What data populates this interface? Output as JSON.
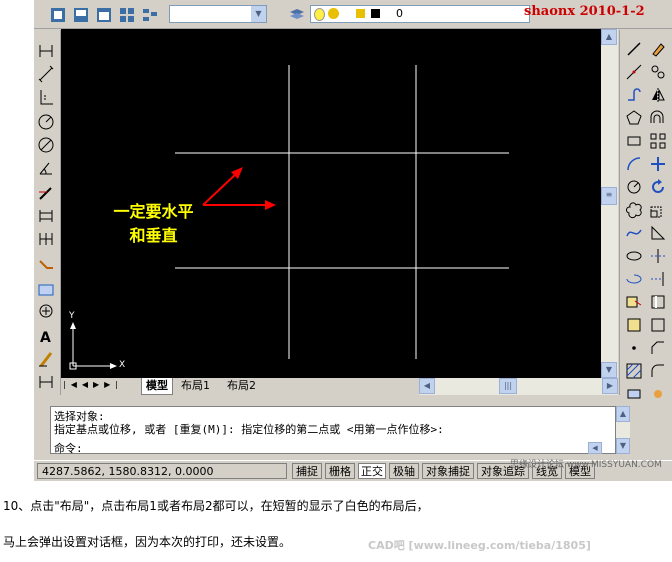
{
  "top_toolbar": {
    "layer_value": "0",
    "watermark": "shaonx  2010-1-2"
  },
  "canvas": {
    "annotation_line1": "一定要水平",
    "annotation_line2": "和垂直",
    "axis_x": "X",
    "axis_y": "Y"
  },
  "tabs": [
    "模型",
    "布局1",
    "布局2"
  ],
  "command": {
    "line1": "选择对象:",
    "line2": "指定基点或位移, 或者 [重复(M)]: 指定位移的第二点或 <用第一点作位移>:",
    "prompt": "命令:"
  },
  "status_bar": {
    "coordinates": "4287.5862, 1580.8312, 0.0000",
    "toggles": [
      "捕捉",
      "栅格",
      "正交",
      "极轴",
      "对象捕捉",
      "对象追踪",
      "线宽",
      "模型"
    ],
    "watermark": "思缘设计论坛 www.MISSYUAN.COM"
  },
  "captions": {
    "line1": "10、点击\"布局\"，点击布局1或者布局2都可以，在短暂的显示了白色的布局后，",
    "line2": "马上会弹出设置对话框，因为本次的打印，还未设置。",
    "watermark": "CAD吧  [www.lineeg.com/tieba/1805]"
  },
  "colors": {
    "canvas_bg": "#000000",
    "annotation": "#ffff00",
    "arrow": "#ff0000",
    "watermark": "#cc0000",
    "chrome": "#d4d0c8"
  }
}
